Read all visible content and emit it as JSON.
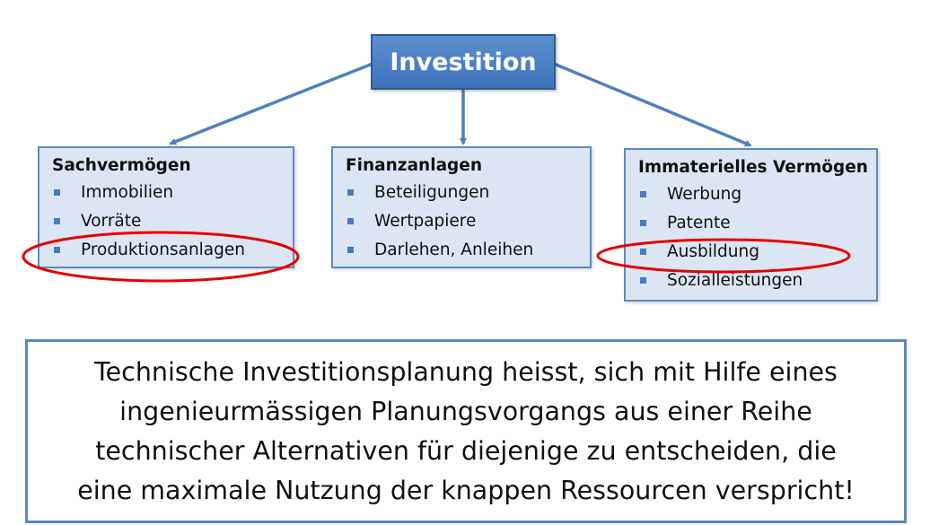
{
  "root": {
    "label": "Investition"
  },
  "categories": [
    {
      "title": "Sachvermögen",
      "items": [
        "Immobilien",
        "Vorräte",
        "Produktionsanlagen"
      ]
    },
    {
      "title": "Finanzanlagen",
      "items": [
        "Beteiligungen",
        "Wertpapiere",
        "Darlehen, Anleihen"
      ]
    },
    {
      "title": "Immaterielles Vermögen",
      "items": [
        "Werbung",
        "Patente",
        "Ausbildung",
        "Sozialleistungen"
      ]
    }
  ],
  "highlighted_items": [
    "Produktionsanlagen",
    "Ausbildung"
  ],
  "colors": {
    "root_fill": "#4a80c4",
    "box_fill": "#dbe5f3",
    "box_border": "#5f8ac2",
    "connector": "#4f81bd",
    "highlight": "#e60000"
  },
  "statement": {
    "lines": [
      "Technische Investitionsplanung heisst, sich mit Hilfe eines",
      "ingenieurmässigen Planungsvorgangs aus einer Reihe",
      "technischer Alternativen für diejenige zu entscheiden, die",
      "eine maximale Nutzung der knappen Ressourcen verspricht!"
    ]
  }
}
